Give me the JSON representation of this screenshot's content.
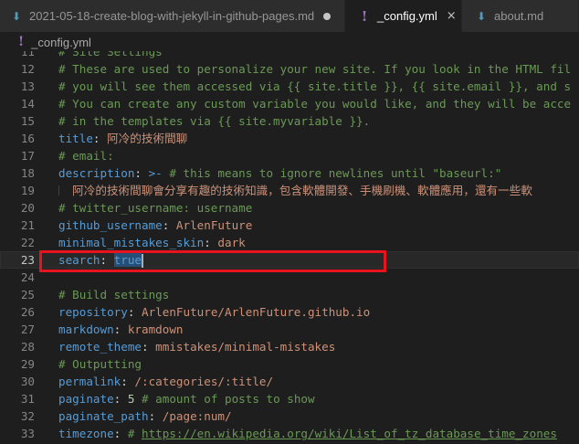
{
  "tabs": [
    {
      "label": "2021-05-18-create-blog-with-jekyll-in-github-pages.md",
      "icon": "markdown-icon",
      "modified": true
    },
    {
      "label": "_config.yml",
      "icon": "yaml-icon",
      "active": true,
      "close": "×"
    },
    {
      "label": "about.md",
      "icon": "markdown-icon"
    }
  ],
  "glyphs": {
    "md": "⬇",
    "yml": "!"
  },
  "breadcrumb": {
    "file": "_config.yml"
  },
  "editor": {
    "lines": [
      {
        "n": "11",
        "parts": [
          {
            "t": "# Site Settings",
            "c": "cmt"
          }
        ]
      },
      {
        "n": "12",
        "parts": [
          {
            "t": "# These are used to personalize your new site. If you look in the HTML fil",
            "c": "cmt"
          }
        ]
      },
      {
        "n": "13",
        "parts": [
          {
            "t": "# you will see them accessed via {{ site.title }}, {{ site.email }}, and s",
            "c": "cmt"
          }
        ]
      },
      {
        "n": "14",
        "parts": [
          {
            "t": "# You can create any custom variable you would like, and they will be acce",
            "c": "cmt"
          }
        ]
      },
      {
        "n": "15",
        "parts": [
          {
            "t": "# in the templates via {{ site.myvariable }}.",
            "c": "cmt"
          }
        ]
      },
      {
        "n": "16",
        "parts": [
          {
            "t": "title",
            "c": "key"
          },
          {
            "t": ": ",
            "c": "pun"
          },
          {
            "t": "阿冷的技術間聊",
            "c": "str"
          }
        ]
      },
      {
        "n": "17",
        "parts": [
          {
            "t": "# email:",
            "c": "cmt"
          }
        ]
      },
      {
        "n": "18",
        "parts": [
          {
            "t": "description",
            "c": "key"
          },
          {
            "t": ": ",
            "c": "pun"
          },
          {
            "t": ">-",
            "c": "key"
          },
          {
            "t": " # this means to ignore newlines until \"baseurl:\"",
            "c": "cmt"
          }
        ]
      },
      {
        "n": "19",
        "guide": true,
        "parts": [
          {
            "t": "  阿冷的技術間聊會分享有趣的技術知識，包含軟體開發、手機刷機、軟體應用，還有一些軟",
            "c": "str"
          }
        ]
      },
      {
        "n": "20",
        "parts": [
          {
            "t": "# twitter_username: username",
            "c": "cmt"
          }
        ]
      },
      {
        "n": "21",
        "parts": [
          {
            "t": "github_username",
            "c": "key"
          },
          {
            "t": ": ",
            "c": "pun"
          },
          {
            "t": "ArlenFuture",
            "c": "str"
          }
        ]
      },
      {
        "n": "22",
        "parts": [
          {
            "t": "minimal_mistakes_skin",
            "c": "key"
          },
          {
            "t": ": ",
            "c": "pun"
          },
          {
            "t": "dark",
            "c": "str"
          }
        ]
      },
      {
        "n": "23",
        "current": true,
        "parts": [
          {
            "t": "search",
            "c": "key"
          },
          {
            "t": ": ",
            "c": "pun"
          },
          {
            "t": "true",
            "c": "key sel"
          }
        ]
      },
      {
        "n": "24",
        "parts": []
      },
      {
        "n": "25",
        "parts": [
          {
            "t": "# Build settings",
            "c": "cmt"
          }
        ]
      },
      {
        "n": "26",
        "parts": [
          {
            "t": "repository",
            "c": "key"
          },
          {
            "t": ": ",
            "c": "pun"
          },
          {
            "t": "ArlenFuture/ArlenFuture.github.io",
            "c": "str"
          }
        ]
      },
      {
        "n": "27",
        "parts": [
          {
            "t": "markdown",
            "c": "key"
          },
          {
            "t": ": ",
            "c": "pun"
          },
          {
            "t": "kramdown",
            "c": "str"
          }
        ]
      },
      {
        "n": "28",
        "parts": [
          {
            "t": "remote_theme",
            "c": "key"
          },
          {
            "t": ": ",
            "c": "pun"
          },
          {
            "t": "mmistakes/minimal-mistakes",
            "c": "str"
          }
        ]
      },
      {
        "n": "29",
        "parts": [
          {
            "t": "# Outputting",
            "c": "cmt"
          }
        ]
      },
      {
        "n": "30",
        "parts": [
          {
            "t": "permalink",
            "c": "key"
          },
          {
            "t": ": ",
            "c": "pun"
          },
          {
            "t": "/:categories/:title/",
            "c": "str"
          }
        ]
      },
      {
        "n": "31",
        "parts": [
          {
            "t": "paginate",
            "c": "key"
          },
          {
            "t": ": ",
            "c": "pun"
          },
          {
            "t": "5",
            "c": "num"
          },
          {
            "t": " # amount of posts to show",
            "c": "cmt"
          }
        ]
      },
      {
        "n": "32",
        "parts": [
          {
            "t": "paginate_path",
            "c": "key"
          },
          {
            "t": ": ",
            "c": "pun"
          },
          {
            "t": "/page:num/",
            "c": "str"
          }
        ]
      },
      {
        "n": "33",
        "parts": [
          {
            "t": "timezone",
            "c": "key"
          },
          {
            "t": ": ",
            "c": "pun"
          },
          {
            "t": "# ",
            "c": "cmt"
          },
          {
            "t": "https://en.wikipedia.org/wiki/List_of_tz_database_time_zones",
            "c": "url"
          }
        ]
      }
    ]
  },
  "colors": {
    "background": "#1e1e1e",
    "tabbar": "#252526",
    "comment": "#6a9955",
    "key": "#569cd6",
    "string": "#ce9178",
    "number": "#b5cea8",
    "annotation_box": "#e8131f"
  }
}
